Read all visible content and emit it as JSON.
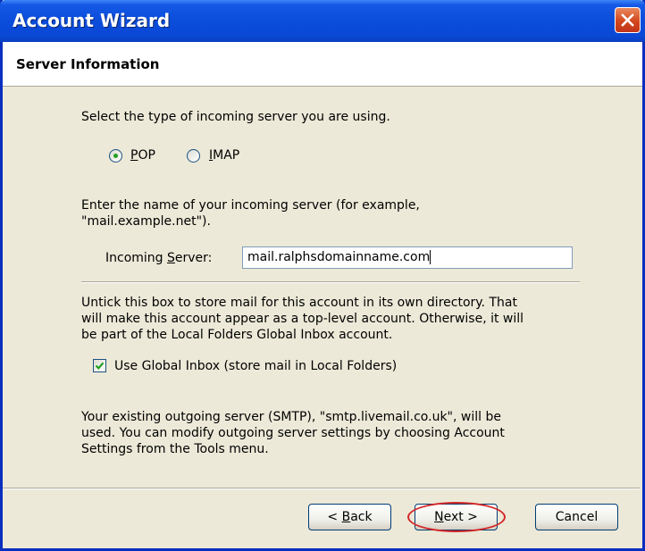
{
  "window": {
    "title": "Account Wizard",
    "close_icon": "close-icon"
  },
  "header": {
    "title": "Server Information"
  },
  "server_type": {
    "prompt": "Select the type of incoming server you are using.",
    "options": [
      {
        "label_prefix": "",
        "label_underlined": "P",
        "label_suffix": "OP",
        "selected": true
      },
      {
        "label_prefix": "",
        "label_underlined": "I",
        "label_suffix": "MAP",
        "selected": false
      }
    ]
  },
  "incoming": {
    "prompt_line1": "Enter the name of your incoming server (for example,",
    "prompt_line2": "\"mail.example.net\").",
    "label_prefix": "Incoming ",
    "label_underlined": "S",
    "label_suffix": "erver:",
    "value": "mail.ralphsdomainname.com"
  },
  "global_inbox": {
    "desc_line1": "Untick this box to store mail for this account in its own directory. That",
    "desc_line2": "will make this account appear as a top-level account. Otherwise, it will",
    "desc_line3": "be part of the Local Folders Global Inbox account.",
    "checkbox_label": "Use Global Inbox (store mail in Local Folders)",
    "checked": true
  },
  "outgoing": {
    "line1": "Your existing outgoing server (SMTP), \"smtp.livemail.co.uk\", will be",
    "line2": "used. You can modify outgoing server settings by choosing Account",
    "line3": "Settings from the Tools menu."
  },
  "buttons": {
    "back_prefix": "< ",
    "back_underlined": "B",
    "back_suffix": "ack",
    "next_underlined": "N",
    "next_suffix": "ext >",
    "cancel": "Cancel"
  },
  "colors": {
    "titlebar": "#0a48d6",
    "close_button": "#d3471d",
    "annotation_oval": "#d42828"
  }
}
